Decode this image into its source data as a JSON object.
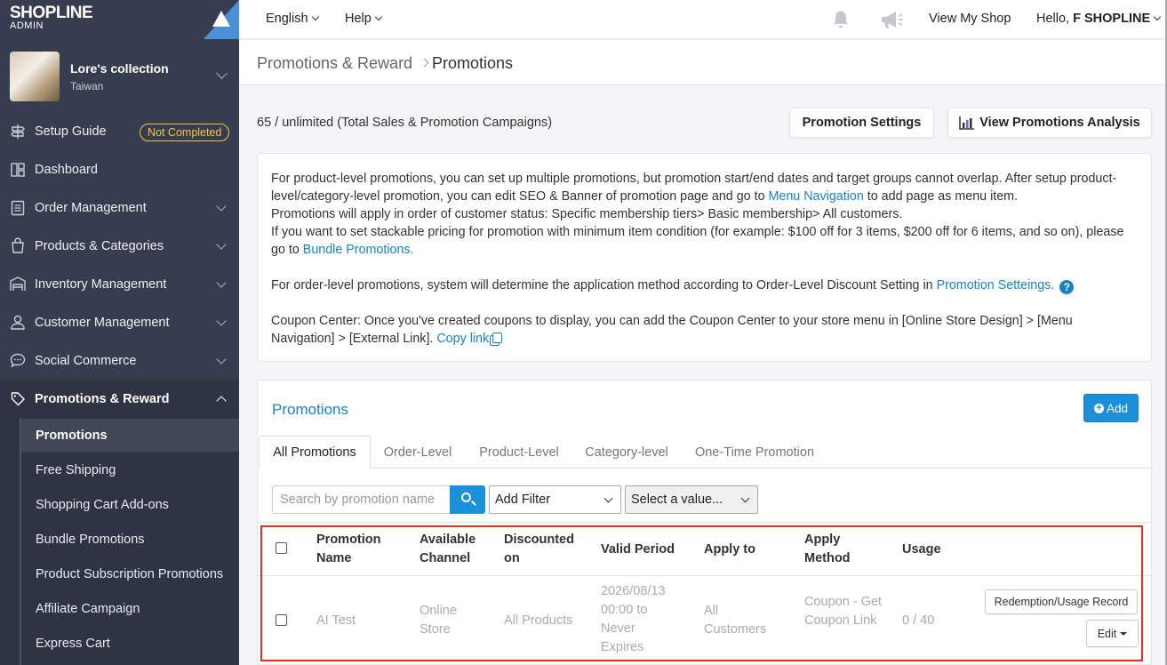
{
  "brand": {
    "logo": "SHOPLINE",
    "sub": "ADMIN"
  },
  "store": {
    "name": "Lore's collection",
    "location": "Taiwan"
  },
  "sidebar": {
    "items": [
      {
        "label": "Setup Guide",
        "icon": "signpost-icon",
        "badge": "Not Completed"
      },
      {
        "label": "Dashboard",
        "icon": "dashboard-icon"
      },
      {
        "label": "Order Management",
        "icon": "clipboard-icon"
      },
      {
        "label": "Products & Categories",
        "icon": "bag-icon"
      },
      {
        "label": "Inventory Management",
        "icon": "warehouse-icon"
      },
      {
        "label": "Customer Management",
        "icon": "user-icon"
      },
      {
        "label": "Social Commerce",
        "icon": "chat-icon"
      },
      {
        "label": "Promotions & Reward",
        "icon": "tag-icon"
      }
    ],
    "sub_items": [
      "Promotions",
      "Free Shipping",
      "Shopping Cart Add-ons",
      "Bundle Promotions",
      "Product Subscription Promotions",
      "Affiliate Campaign",
      "Express Cart"
    ]
  },
  "topbar": {
    "language": "English",
    "help": "Help",
    "view_shop": "View My Shop",
    "greeting": "Hello,",
    "user": "F SHOPLINE"
  },
  "breadcrumb": {
    "parent": "Promotions & Reward",
    "current": "Promotions"
  },
  "limit_text": "65 / unlimited (Total Sales & Promotion Campaigns)",
  "buttons": {
    "settings": "Promotion Settings",
    "analysis": "View Promotions Analysis",
    "add": "Add"
  },
  "info": {
    "p1a": "For product-level promotions, you can set up multiple promotions, but promotion start/end dates and target groups cannot overlap. After setup product-level/category-level promotion, you can edit SEO & Banner of promotion page and go to ",
    "p1_link": "Menu Navigation",
    "p1b": " to add page as menu item.",
    "p2": "Promotions will apply in order of customer status: Specific membership tiers> Basic membership> All customers.",
    "p3a": "If you want to set stackable pricing for promotion with minimum item condition (for example: $100 off for 3 items, $200 off for 6 items, and so on), please go to ",
    "p3_link": "Bundle Promotions.",
    "p4a": "For order-level promotions, system will determine the application method according to Order-Level Discount Setting in ",
    "p4_link": "Promotion Setteings.",
    "p5a": "Coupon Center: Once you've created coupons to display, you can add the Coupon Center to your store menu in [Online Store Design] > [Menu Navigation] > [External Link]. ",
    "p5_link": "Copy link"
  },
  "panel": {
    "title": "Promotions"
  },
  "tabs": [
    "All Promotions",
    "Order-Level",
    "Product-Level",
    "Category-level",
    "One-Time Promotion"
  ],
  "filters": {
    "search_placeholder": "Search by promotion name",
    "filter": "Add Filter",
    "value": "Select a value..."
  },
  "table": {
    "headers": [
      "Promotion Name",
      "Available Channel",
      "Discounted on",
      "Valid Period",
      "Apply to",
      "Apply Method",
      "Usage"
    ],
    "rows": [
      {
        "name": "AI Test",
        "channel": "Online Store",
        "discounted": "All Products",
        "period": "2026/08/13 00:00 to Never Expires",
        "apply_to": "All Customers",
        "method": "Coupon - Get Coupon Link",
        "usage": "0 / 40",
        "record_btn": "Redemption/Usage Record",
        "edit_btn": "Edit"
      }
    ]
  },
  "colors": {
    "sidebar": "#363d4f",
    "accent": "#1a82c4",
    "badge": "#f5c542",
    "highlight": "#e0321f"
  }
}
